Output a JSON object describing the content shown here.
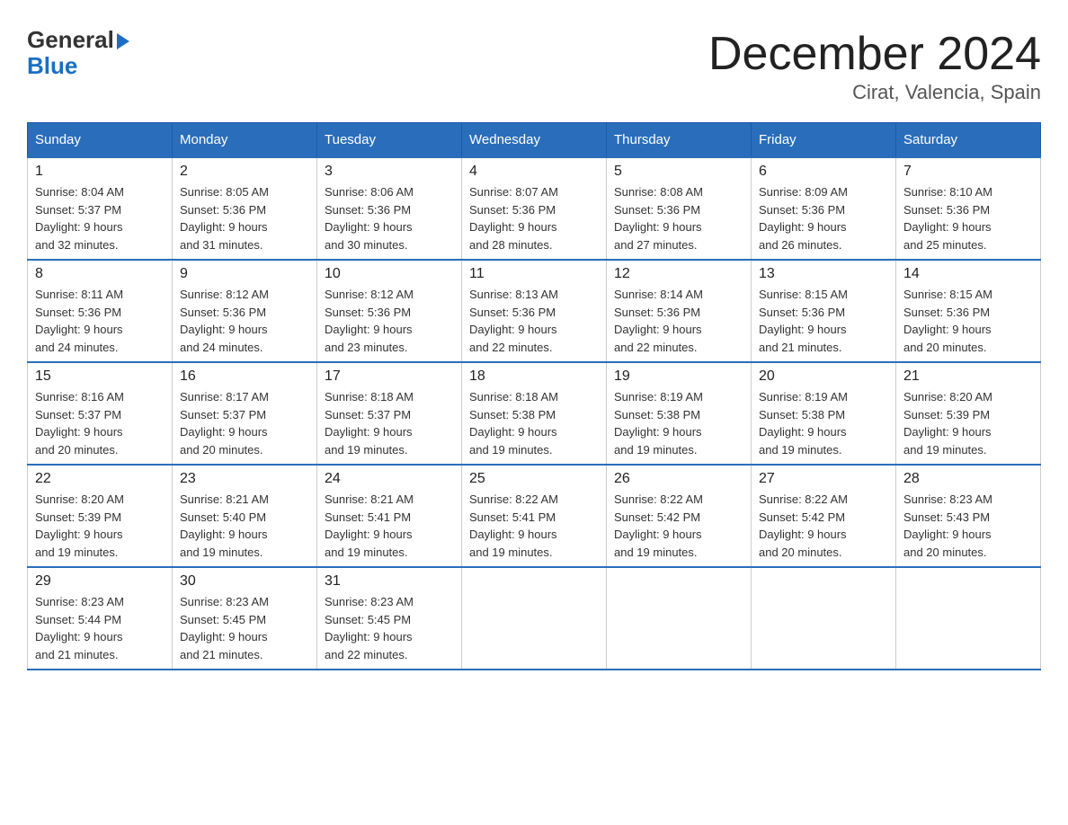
{
  "header": {
    "logo_line1": "General",
    "logo_line2": "Blue",
    "title": "December 2024",
    "subtitle": "Cirat, Valencia, Spain"
  },
  "days_of_week": [
    "Sunday",
    "Monday",
    "Tuesday",
    "Wednesday",
    "Thursday",
    "Friday",
    "Saturday"
  ],
  "weeks": [
    [
      {
        "day": "1",
        "sunrise": "Sunrise: 8:04 AM",
        "sunset": "Sunset: 5:37 PM",
        "daylight": "Daylight: 9 hours",
        "minutes": "and 32 minutes."
      },
      {
        "day": "2",
        "sunrise": "Sunrise: 8:05 AM",
        "sunset": "Sunset: 5:36 PM",
        "daylight": "Daylight: 9 hours",
        "minutes": "and 31 minutes."
      },
      {
        "day": "3",
        "sunrise": "Sunrise: 8:06 AM",
        "sunset": "Sunset: 5:36 PM",
        "daylight": "Daylight: 9 hours",
        "minutes": "and 30 minutes."
      },
      {
        "day": "4",
        "sunrise": "Sunrise: 8:07 AM",
        "sunset": "Sunset: 5:36 PM",
        "daylight": "Daylight: 9 hours",
        "minutes": "and 28 minutes."
      },
      {
        "day": "5",
        "sunrise": "Sunrise: 8:08 AM",
        "sunset": "Sunset: 5:36 PM",
        "daylight": "Daylight: 9 hours",
        "minutes": "and 27 minutes."
      },
      {
        "day": "6",
        "sunrise": "Sunrise: 8:09 AM",
        "sunset": "Sunset: 5:36 PM",
        "daylight": "Daylight: 9 hours",
        "minutes": "and 26 minutes."
      },
      {
        "day": "7",
        "sunrise": "Sunrise: 8:10 AM",
        "sunset": "Sunset: 5:36 PM",
        "daylight": "Daylight: 9 hours",
        "minutes": "and 25 minutes."
      }
    ],
    [
      {
        "day": "8",
        "sunrise": "Sunrise: 8:11 AM",
        "sunset": "Sunset: 5:36 PM",
        "daylight": "Daylight: 9 hours",
        "minutes": "and 24 minutes."
      },
      {
        "day": "9",
        "sunrise": "Sunrise: 8:12 AM",
        "sunset": "Sunset: 5:36 PM",
        "daylight": "Daylight: 9 hours",
        "minutes": "and 24 minutes."
      },
      {
        "day": "10",
        "sunrise": "Sunrise: 8:12 AM",
        "sunset": "Sunset: 5:36 PM",
        "daylight": "Daylight: 9 hours",
        "minutes": "and 23 minutes."
      },
      {
        "day": "11",
        "sunrise": "Sunrise: 8:13 AM",
        "sunset": "Sunset: 5:36 PM",
        "daylight": "Daylight: 9 hours",
        "minutes": "and 22 minutes."
      },
      {
        "day": "12",
        "sunrise": "Sunrise: 8:14 AM",
        "sunset": "Sunset: 5:36 PM",
        "daylight": "Daylight: 9 hours",
        "minutes": "and 22 minutes."
      },
      {
        "day": "13",
        "sunrise": "Sunrise: 8:15 AM",
        "sunset": "Sunset: 5:36 PM",
        "daylight": "Daylight: 9 hours",
        "minutes": "and 21 minutes."
      },
      {
        "day": "14",
        "sunrise": "Sunrise: 8:15 AM",
        "sunset": "Sunset: 5:36 PM",
        "daylight": "Daylight: 9 hours",
        "minutes": "and 20 minutes."
      }
    ],
    [
      {
        "day": "15",
        "sunrise": "Sunrise: 8:16 AM",
        "sunset": "Sunset: 5:37 PM",
        "daylight": "Daylight: 9 hours",
        "minutes": "and 20 minutes."
      },
      {
        "day": "16",
        "sunrise": "Sunrise: 8:17 AM",
        "sunset": "Sunset: 5:37 PM",
        "daylight": "Daylight: 9 hours",
        "minutes": "and 20 minutes."
      },
      {
        "day": "17",
        "sunrise": "Sunrise: 8:18 AM",
        "sunset": "Sunset: 5:37 PM",
        "daylight": "Daylight: 9 hours",
        "minutes": "and 19 minutes."
      },
      {
        "day": "18",
        "sunrise": "Sunrise: 8:18 AM",
        "sunset": "Sunset: 5:38 PM",
        "daylight": "Daylight: 9 hours",
        "minutes": "and 19 minutes."
      },
      {
        "day": "19",
        "sunrise": "Sunrise: 8:19 AM",
        "sunset": "Sunset: 5:38 PM",
        "daylight": "Daylight: 9 hours",
        "minutes": "and 19 minutes."
      },
      {
        "day": "20",
        "sunrise": "Sunrise: 8:19 AM",
        "sunset": "Sunset: 5:38 PM",
        "daylight": "Daylight: 9 hours",
        "minutes": "and 19 minutes."
      },
      {
        "day": "21",
        "sunrise": "Sunrise: 8:20 AM",
        "sunset": "Sunset: 5:39 PM",
        "daylight": "Daylight: 9 hours",
        "minutes": "and 19 minutes."
      }
    ],
    [
      {
        "day": "22",
        "sunrise": "Sunrise: 8:20 AM",
        "sunset": "Sunset: 5:39 PM",
        "daylight": "Daylight: 9 hours",
        "minutes": "and 19 minutes."
      },
      {
        "day": "23",
        "sunrise": "Sunrise: 8:21 AM",
        "sunset": "Sunset: 5:40 PM",
        "daylight": "Daylight: 9 hours",
        "minutes": "and 19 minutes."
      },
      {
        "day": "24",
        "sunrise": "Sunrise: 8:21 AM",
        "sunset": "Sunset: 5:41 PM",
        "daylight": "Daylight: 9 hours",
        "minutes": "and 19 minutes."
      },
      {
        "day": "25",
        "sunrise": "Sunrise: 8:22 AM",
        "sunset": "Sunset: 5:41 PM",
        "daylight": "Daylight: 9 hours",
        "minutes": "and 19 minutes."
      },
      {
        "day": "26",
        "sunrise": "Sunrise: 8:22 AM",
        "sunset": "Sunset: 5:42 PM",
        "daylight": "Daylight: 9 hours",
        "minutes": "and 19 minutes."
      },
      {
        "day": "27",
        "sunrise": "Sunrise: 8:22 AM",
        "sunset": "Sunset: 5:42 PM",
        "daylight": "Daylight: 9 hours",
        "minutes": "and 20 minutes."
      },
      {
        "day": "28",
        "sunrise": "Sunrise: 8:23 AM",
        "sunset": "Sunset: 5:43 PM",
        "daylight": "Daylight: 9 hours",
        "minutes": "and 20 minutes."
      }
    ],
    [
      {
        "day": "29",
        "sunrise": "Sunrise: 8:23 AM",
        "sunset": "Sunset: 5:44 PM",
        "daylight": "Daylight: 9 hours",
        "minutes": "and 21 minutes."
      },
      {
        "day": "30",
        "sunrise": "Sunrise: 8:23 AM",
        "sunset": "Sunset: 5:45 PM",
        "daylight": "Daylight: 9 hours",
        "minutes": "and 21 minutes."
      },
      {
        "day": "31",
        "sunrise": "Sunrise: 8:23 AM",
        "sunset": "Sunset: 5:45 PM",
        "daylight": "Daylight: 9 hours",
        "minutes": "and 22 minutes."
      },
      {
        "day": "",
        "sunrise": "",
        "sunset": "",
        "daylight": "",
        "minutes": ""
      },
      {
        "day": "",
        "sunrise": "",
        "sunset": "",
        "daylight": "",
        "minutes": ""
      },
      {
        "day": "",
        "sunrise": "",
        "sunset": "",
        "daylight": "",
        "minutes": ""
      },
      {
        "day": "",
        "sunrise": "",
        "sunset": "",
        "daylight": "",
        "minutes": ""
      }
    ]
  ]
}
